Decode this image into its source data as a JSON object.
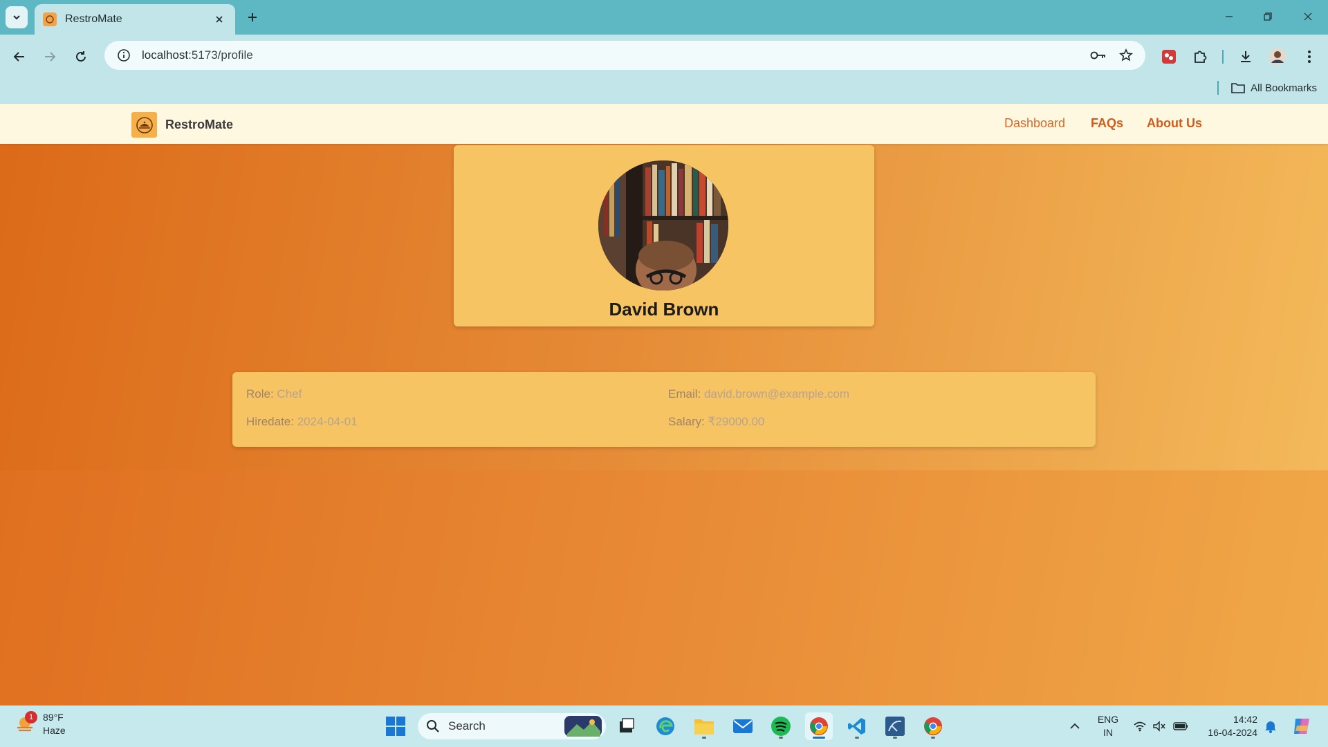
{
  "browser": {
    "tab_title": "RestroMate",
    "url_host": "localhost",
    "url_rest": ":5173/profile",
    "bookmarks_label": "All Bookmarks"
  },
  "app": {
    "brand_name": "RestroMate",
    "nav": {
      "dashboard": "Dashboard",
      "faqs": "FAQs",
      "about": "About Us"
    }
  },
  "profile": {
    "name": "David Brown",
    "role_label": "Role:",
    "role": "Chef",
    "email_label": "Email:",
    "email": "david.brown@example.com",
    "hiredate_label": "Hiredate:",
    "hiredate": "2024-04-01",
    "salary_label": "Salary:",
    "salary": "₹29000.00"
  },
  "taskbar": {
    "weather_temp": "89°F",
    "weather_desc": "Haze",
    "weather_badge": "1",
    "search_label": "Search",
    "lang_line1": "ENG",
    "lang_line2": "IN",
    "time": "14:42",
    "date": "16-04-2024"
  },
  "colors": {
    "accent": "#e07a2a",
    "card": "#f6c462",
    "nav_bg": "#fff8e1",
    "chrome": "#5db8c4"
  }
}
